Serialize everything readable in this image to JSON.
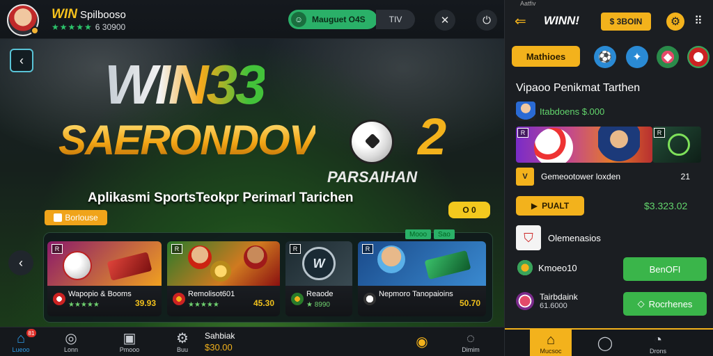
{
  "header": {
    "brand_win": "WIN",
    "app_name": "Spilbooso",
    "stars": "★★★★★",
    "balance": "6 30900",
    "promo_label": "Mauguet O4S",
    "tv_label": "TIV"
  },
  "hero": {
    "logo_line1": "WIN33",
    "logo_line2": "SAERONDOV",
    "logo_number": "2",
    "logo_sub": "PARSAIHAN",
    "tagline": "Aplikasmi SportsTeokpr Perimarl Tarichen",
    "tag_label": "Borlouse",
    "yellow_label": "O 0"
  },
  "games_head": [
    "Mooo",
    "Sao"
  ],
  "games": [
    {
      "title": "Wapopio & Booms",
      "price": "39.93",
      "sub": "★★★★★"
    },
    {
      "title": "Remolisot601",
      "price": "45.30",
      "sub": "★★★★★"
    },
    {
      "title": "Reaode",
      "price": "",
      "sub": "★ 8990"
    },
    {
      "title": "Nepmoro Tanopaioins",
      "price": "50.70",
      "sub": ""
    }
  ],
  "bottom_left": {
    "badge": "81",
    "labels": [
      "Lueoo",
      "Lonn",
      "Pmooo",
      "Buu"
    ],
    "balance_title": "Sahbiak",
    "balance_value": "$30.00",
    "right_labels": [
      "",
      "Dimim"
    ]
  },
  "right": {
    "status": "Aatfiv",
    "title": "WINN!",
    "balance": "$ 3BOIN",
    "tab_label": "Mathioes",
    "heading": "Vipaoo Penikmat Tarthen",
    "row1": "Itabdoens $.000",
    "row2": "Gemeootower loxden",
    "row2_num": "21",
    "bet_label": "PUALT",
    "amount": "$3.323.02",
    "row3": "Olemenasios",
    "row4": "Kmoeo10",
    "btn1": "BenOFI",
    "row5_title": "Tairbdaink",
    "row5_sub": "61.6000",
    "btn2": "Rocrhenes",
    "nav_labels": [
      "Mucsoc",
      "",
      "Drons"
    ]
  }
}
